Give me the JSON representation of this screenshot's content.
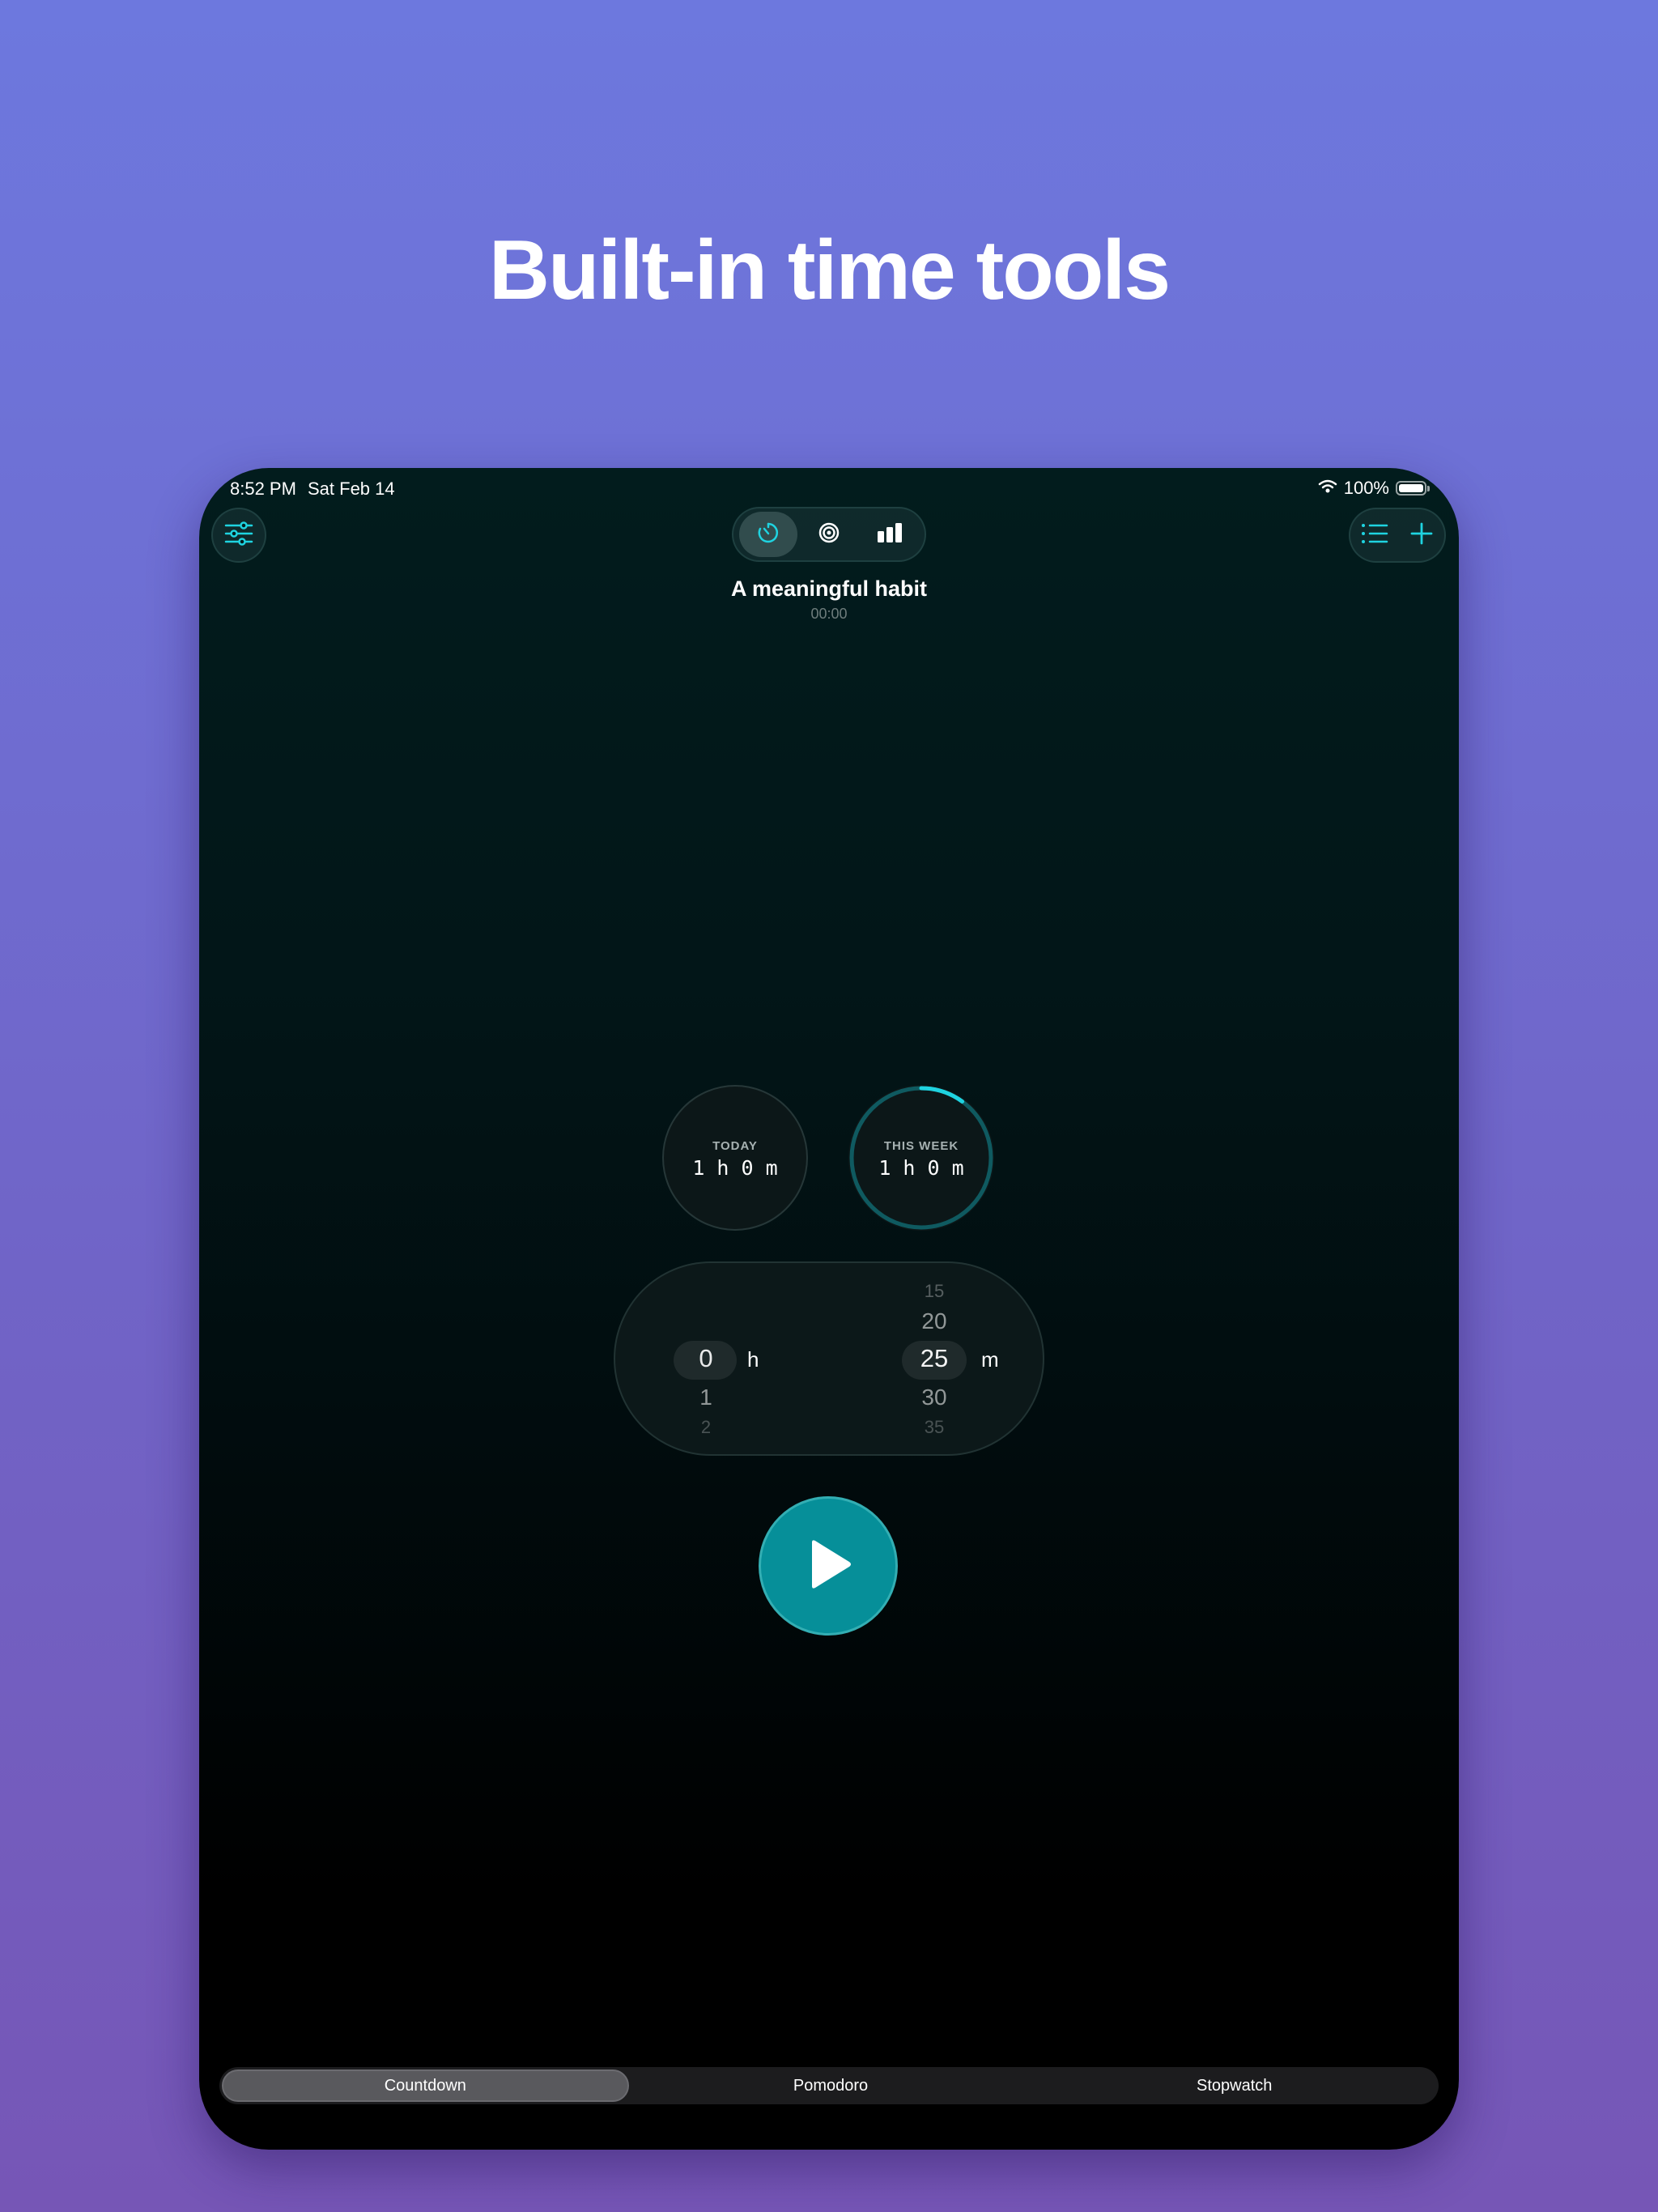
{
  "headline": "Built-in time tools",
  "status_bar": {
    "time": "8:52 PM",
    "date": "Sat Feb 14",
    "battery": "100%"
  },
  "toolbar": {
    "settings_icon": "sliders-icon",
    "segments": [
      {
        "icon": "timer-icon",
        "active": true
      },
      {
        "icon": "target-icon",
        "active": false
      },
      {
        "icon": "bar-chart-icon",
        "active": false
      }
    ],
    "list_icon": "list-icon",
    "add_icon": "plus-icon"
  },
  "habit": {
    "title": "A meaningful habit",
    "elapsed": "00:00"
  },
  "stats": {
    "today": {
      "label": "TODAY",
      "value": "1 h 0 m"
    },
    "week": {
      "label": "THIS WEEK",
      "value": "1 h 0 m",
      "progress": 0.1
    }
  },
  "picker": {
    "hours": {
      "values": [
        "0",
        "1",
        "2"
      ],
      "selected": "0",
      "unit": "h"
    },
    "minutes": {
      "values": [
        "15",
        "20",
        "25",
        "30",
        "35"
      ],
      "selected": "25",
      "unit": "m"
    }
  },
  "play_icon": "play-icon",
  "tabs": [
    {
      "label": "Countdown",
      "active": true
    },
    {
      "label": "Pomodoro",
      "active": false
    },
    {
      "label": "Stopwatch",
      "active": false
    }
  ],
  "colors": {
    "accent": "#1fd3e0",
    "play_button": "#068f99",
    "ring_track": "#0f5a60"
  }
}
